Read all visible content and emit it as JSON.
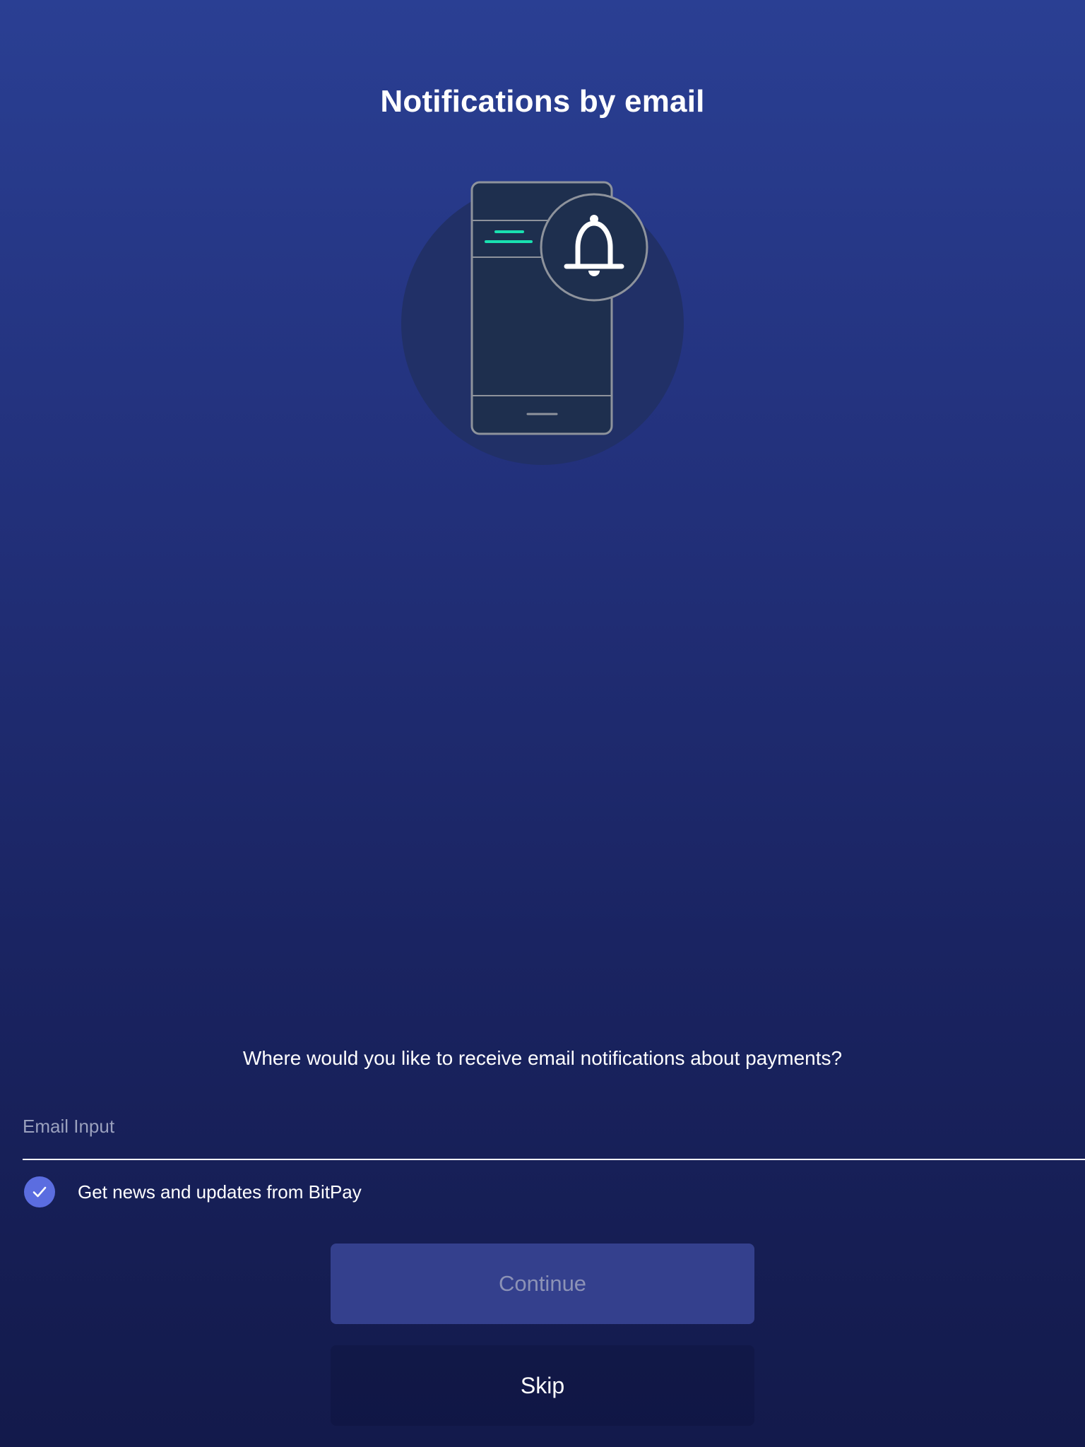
{
  "header": {
    "title": "Notifications by email"
  },
  "illustration": {
    "icon": "phone-with-bell-icon",
    "colors": {
      "backdrop": "#213067",
      "phone_fill": "#1e2f4e",
      "outline": "#8e939c",
      "accent": "#19e0b0",
      "bell": "#ffffff"
    }
  },
  "form": {
    "question": "Where would you like to receive email notifications about payments?",
    "email": {
      "placeholder": "Email Input",
      "value": ""
    },
    "optin": {
      "label": "Get news and updates from BitPay",
      "checked": true,
      "icon": "checkmark-icon",
      "color": "#5b6de0"
    }
  },
  "actions": {
    "continue_label": "Continue",
    "continue_enabled": false,
    "skip_label": "Skip"
  },
  "theme": {
    "gradient_top": "#2a3f93",
    "gradient_bottom": "#131a4b",
    "button_disabled_bg": "#34408d",
    "button_disabled_text": "#8c92b6"
  }
}
